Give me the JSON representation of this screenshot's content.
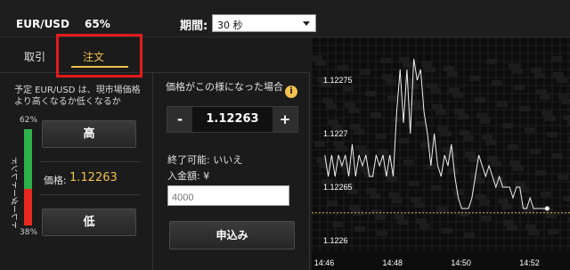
{
  "header": {
    "pair": "EUR/USD",
    "payout": "65%",
    "period_label": "期間:",
    "period_value": "30 秒"
  },
  "tabs": [
    {
      "label": "取引"
    },
    {
      "label": "注文",
      "active": true
    }
  ],
  "info_icon": "info-icon",
  "left": {
    "prediction_text": "予定 EUR/USD は、現市場価格より高くなるか低くなるか",
    "trend_label": "トレーダートレンド",
    "trend_up_pct": "62%",
    "trend_down_pct": "38%",
    "trend_up_value": 62,
    "high_button": "高",
    "price_label": "価格:",
    "price_value": "1.12263",
    "low_button": "低"
  },
  "middle": {
    "condition_label": "価格がこの様になった場合",
    "minus": "-",
    "stepper_value": "1.12263",
    "plus": "+",
    "end_label": "終了可能: いいえ",
    "amount_label": "入金額: ¥",
    "amount_placeholder": "4000",
    "apply_button": "申込み"
  },
  "colors": {
    "accent": "#f2c14e",
    "highlight": "#e31b1b",
    "trend_up": "#2db34a",
    "trend_down": "#e8291f"
  },
  "chart_data": {
    "type": "line",
    "y_ticks": [
      "1.12275",
      "1.1227",
      "1.12265",
      "1.1226"
    ],
    "x_ticks": [
      "14:46",
      "14:48",
      "14:50",
      "14:52"
    ],
    "ylim": [
      1.12259,
      1.12279
    ],
    "target_line": 1.122626,
    "series": [
      {
        "values": [
          [
            "14:46:00",
            1.12268
          ],
          [
            "14:46:06",
            1.12266
          ],
          [
            "14:46:12",
            1.12268
          ],
          [
            "14:46:18",
            1.12266
          ],
          [
            "14:46:24",
            1.12268
          ],
          [
            "14:46:30",
            1.12267
          ],
          [
            "14:46:36",
            1.12268
          ],
          [
            "14:46:42",
            1.12266
          ],
          [
            "14:46:48",
            1.12269
          ],
          [
            "14:46:54",
            1.12266
          ],
          [
            "14:47:00",
            1.12268
          ],
          [
            "14:47:06",
            1.12267
          ],
          [
            "14:47:12",
            1.12268
          ],
          [
            "14:47:18",
            1.12266
          ],
          [
            "14:47:24",
            1.12266
          ],
          [
            "14:47:30",
            1.12268
          ],
          [
            "14:47:36",
            1.12267
          ],
          [
            "14:47:42",
            1.12268
          ],
          [
            "14:47:48",
            1.12266
          ],
          [
            "14:47:54",
            1.12268
          ],
          [
            "14:48:00",
            1.12266
          ],
          [
            "14:48:06",
            1.12272
          ],
          [
            "14:48:12",
            1.12276
          ],
          [
            "14:48:18",
            1.12271
          ],
          [
            "14:48:24",
            1.12276
          ],
          [
            "14:48:30",
            1.1227
          ],
          [
            "14:48:36",
            1.12277
          ],
          [
            "14:48:42",
            1.12275
          ],
          [
            "14:48:48",
            1.12276
          ],
          [
            "14:48:54",
            1.12272
          ],
          [
            "14:49:00",
            1.1227
          ],
          [
            "14:49:06",
            1.12267
          ],
          [
            "14:49:12",
            1.1227
          ],
          [
            "14:49:18",
            1.12267
          ],
          [
            "14:49:24",
            1.12266
          ],
          [
            "14:49:30",
            1.12268
          ],
          [
            "14:49:36",
            1.12267
          ],
          [
            "14:49:42",
            1.12269
          ],
          [
            "14:49:48",
            1.12266
          ],
          [
            "14:49:54",
            1.12264
          ],
          [
            "14:50:00",
            1.12263
          ],
          [
            "14:50:06",
            1.12263
          ],
          [
            "14:50:12",
            1.12263
          ],
          [
            "14:50:18",
            1.12264
          ],
          [
            "14:50:24",
            1.12266
          ],
          [
            "14:50:30",
            1.12268
          ],
          [
            "14:50:36",
            1.12267
          ],
          [
            "14:50:42",
            1.12266
          ],
          [
            "14:50:48",
            1.12267
          ],
          [
            "14:50:54",
            1.12266
          ],
          [
            "14:51:00",
            1.12265
          ],
          [
            "14:51:06",
            1.12266
          ],
          [
            "14:51:12",
            1.12265
          ],
          [
            "14:51:18",
            1.12265
          ],
          [
            "14:51:24",
            1.12265
          ],
          [
            "14:51:30",
            1.12264
          ],
          [
            "14:51:36",
            1.12265
          ],
          [
            "14:51:42",
            1.12265
          ],
          [
            "14:51:48",
            1.12263
          ],
          [
            "14:51:54",
            1.12263
          ],
          [
            "14:52:00",
            1.12264
          ],
          [
            "14:52:06",
            1.12263
          ],
          [
            "14:52:12",
            1.12263
          ],
          [
            "14:52:18",
            1.12263
          ],
          [
            "14:52:24",
            1.12263
          ],
          [
            "14:52:30",
            1.12263
          ]
        ]
      }
    ],
    "grid": true
  }
}
